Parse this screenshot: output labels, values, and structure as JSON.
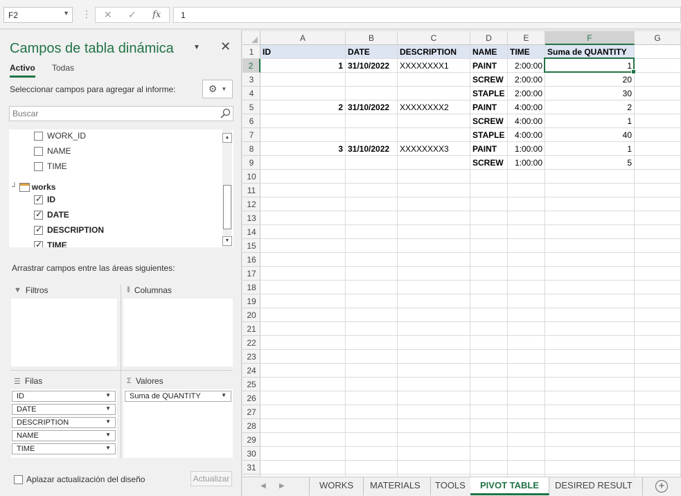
{
  "formula_bar": {
    "name_box": "F2",
    "cancel_icon": "x-icon",
    "enter_icon": "check-icon",
    "fx_label": "fx",
    "formula": "1"
  },
  "pivot_panel": {
    "title": "Campos de tabla dinámica",
    "tabs": [
      "Activo",
      "Todas"
    ],
    "select_label": "Seleccionar campos para agregar al informe:",
    "search_placeholder": "Buscar",
    "fields_above": [
      {
        "label": "WORK_ID",
        "checked": false
      },
      {
        "label": "NAME",
        "checked": false
      },
      {
        "label": "TIME",
        "checked": false
      }
    ],
    "group_name": "works",
    "group_fields": [
      {
        "label": "ID",
        "checked": true
      },
      {
        "label": "DATE",
        "checked": true
      },
      {
        "label": "DESCRIPTION",
        "checked": true
      },
      {
        "label": "TIME",
        "checked": true
      }
    ],
    "drag_label": "Arrastrar campos entre las áreas siguientes:",
    "areas": {
      "filters_title": "Filtros",
      "columns_title": "Columnas",
      "rows_title": "Filas",
      "values_title": "Valores",
      "rows": [
        "ID",
        "DATE",
        "DESCRIPTION",
        "NAME",
        "TIME"
      ],
      "values": [
        "Suma de QUANTITY"
      ]
    },
    "defer_label": "Aplazar actualización del diseño",
    "update_button": "Actualizar"
  },
  "grid": {
    "columns": [
      "A",
      "B",
      "C",
      "D",
      "E",
      "F",
      "G"
    ],
    "rows": [
      "1",
      "2",
      "3",
      "4",
      "5",
      "6",
      "7",
      "8",
      "9",
      "10",
      "11",
      "12",
      "13",
      "14",
      "15",
      "16",
      "17",
      "18",
      "19",
      "20",
      "21",
      "22",
      "23",
      "24",
      "25",
      "26",
      "27",
      "28",
      "29",
      "30",
      "31"
    ],
    "headers": [
      "ID",
      "DATE",
      "DESCRIPTION",
      "NAME",
      "TIME",
      "Suma de QUANTITY"
    ],
    "data": [
      {
        "id": "1",
        "date": "31/10/2022",
        "desc": "XXXXXXXX1",
        "name": "PAINT",
        "time": "2:00:00",
        "qty": "1"
      },
      {
        "id": "",
        "date": "",
        "desc": "",
        "name": "SCREW",
        "time": "2:00:00",
        "qty": "20"
      },
      {
        "id": "",
        "date": "",
        "desc": "",
        "name": "STAPLE",
        "time": "2:00:00",
        "qty": "30"
      },
      {
        "id": "2",
        "date": "31/10/2022",
        "desc": "XXXXXXXX2",
        "name": "PAINT",
        "time": "4:00:00",
        "qty": "2"
      },
      {
        "id": "",
        "date": "",
        "desc": "",
        "name": "SCREW",
        "time": "4:00:00",
        "qty": "1"
      },
      {
        "id": "",
        "date": "",
        "desc": "",
        "name": "STAPLE",
        "time": "4:00:00",
        "qty": "40"
      },
      {
        "id": "3",
        "date": "31/10/2022",
        "desc": "XXXXXXXX3",
        "name": "PAINT",
        "time": "1:00:00",
        "qty": "1"
      },
      {
        "id": "",
        "date": "",
        "desc": "",
        "name": "SCREW",
        "time": "1:00:00",
        "qty": "5"
      }
    ]
  },
  "sheet_tabs": [
    "WORKS",
    "MATERIALS",
    "TOOLS",
    "PIVOT TABLE",
    "DESIRED RESULT"
  ],
  "active_sheet": "PIVOT TABLE",
  "colors": {
    "accent": "#217346",
    "header_fill": "#dde5f3"
  }
}
